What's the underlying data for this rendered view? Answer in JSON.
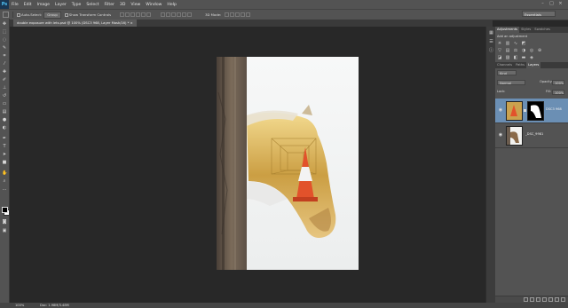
{
  "app": {
    "logo": "Ps"
  },
  "menu": [
    "File",
    "Edit",
    "Image",
    "Layer",
    "Type",
    "Select",
    "Filter",
    "3D",
    "View",
    "Window",
    "Help"
  ],
  "options_bar": {
    "auto_select_label": "Auto-Select:",
    "auto_select_value": "Group",
    "show_transform_label": "Show Transform Controls",
    "mode_label": "3D Mode:",
    "workspace": "Essentials"
  },
  "document": {
    "tab_title": "double exposure with lets.psd @ 100% (DSC3 968, Layer Mask/16) *"
  },
  "status": {
    "zoom": "100%",
    "doc_size": "Doc: 1.98M/3.48M"
  },
  "adjustments_panel": {
    "tabs": [
      "Adjustments",
      "Styles",
      "Swatches"
    ],
    "title": "Add an adjustment"
  },
  "layers_panel": {
    "tabs": [
      "Channels",
      "Paths",
      "Layers"
    ],
    "kind_filter": "Kind",
    "blend_mode": "Normal",
    "opacity_label": "Opacity:",
    "opacity_value": "100%",
    "lock_label": "Lock:",
    "fill_label": "Fill:",
    "fill_value": "100%",
    "layers": [
      {
        "name": "DSC3 968",
        "selected": true
      },
      {
        "name": "_DSC_9981",
        "selected": false
      }
    ]
  },
  "icons": {
    "move_tool": "move-icon",
    "eye": "eye-icon",
    "tools": [
      "marquee-icon",
      "lasso-icon",
      "quick-select-icon",
      "crop-icon",
      "eyedropper-icon",
      "healing-icon",
      "brush-icon",
      "stamp-icon",
      "history-brush-icon",
      "eraser-icon",
      "gradient-icon",
      "blur-icon",
      "dodge-icon",
      "pen-icon",
      "type-icon",
      "path-select-icon",
      "shape-icon",
      "hand-icon",
      "zoom-icon"
    ]
  }
}
